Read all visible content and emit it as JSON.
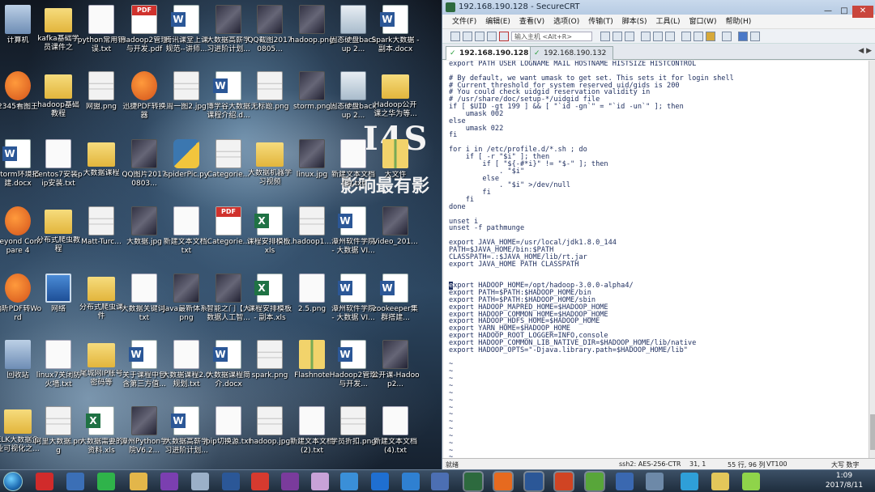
{
  "desktop": {
    "wallpaper_logo": "I4S",
    "wallpaper_subtitle": "影响最有影",
    "icons": [
      {
        "label": "计算机",
        "type": "sys"
      },
      {
        "label": "kafka基础学员课件之",
        "type": "folder"
      },
      {
        "label": "python常用错误.txt",
        "type": "txt"
      },
      {
        "label": "Hadoop2管理与开发.pdf",
        "type": "pdf"
      },
      {
        "label": "腾讯课堂上课规范--讲师...",
        "type": "doc"
      },
      {
        "label": "大数据高薪学习进阶计划...",
        "type": "jpg"
      },
      {
        "label": "QQ截图20170805...",
        "type": "jpg"
      },
      {
        "label": "hadoop.png",
        "type": "jpg"
      },
      {
        "label": "固态硬盘backup 2...",
        "type": "exe"
      },
      {
        "label": "Spark大数据 - 副本.docx",
        "type": "doc"
      },
      {
        "label": "2345看图王",
        "type": "app"
      },
      {
        "label": "hadoop基础教程",
        "type": "folder"
      },
      {
        "label": "网盟.png",
        "type": "png"
      },
      {
        "label": "迅捷PDF转换器",
        "type": "app"
      },
      {
        "label": "周一图2.jpg",
        "type": "png"
      },
      {
        "label": "博学谷大数据课程介绍.d...",
        "type": "doc"
      },
      {
        "label": "无标题.png",
        "type": "png"
      },
      {
        "label": "storm.png",
        "type": "jpg"
      },
      {
        "label": "固态硬盘backup 2...",
        "type": "exe"
      },
      {
        "label": "Hadoop公开课之华为等...",
        "type": "folder"
      },
      {
        "label": "storm环境搭建.docx",
        "type": "doc"
      },
      {
        "label": "centos7安装pip安装.txt",
        "type": "txt"
      },
      {
        "label": "大数据课程",
        "type": "folder"
      },
      {
        "label": "QQ图片20170803...",
        "type": "jpg"
      },
      {
        "label": "spiderPic.py",
        "type": "py"
      },
      {
        "label": "Categorie...",
        "type": "png"
      },
      {
        "label": "大数据机器学习视频",
        "type": "folder"
      },
      {
        "label": "linux.jpg",
        "type": "jpg"
      },
      {
        "label": "新建文本文档(3).txt",
        "type": "txt"
      },
      {
        "label": "大文件",
        "type": "zip"
      },
      {
        "label": "Beyond Compare 4",
        "type": "app"
      },
      {
        "label": "分布式爬虫教程",
        "type": "folder"
      },
      {
        "label": "Matt-Turc...",
        "type": "png"
      },
      {
        "label": "大数据.jpg",
        "type": "jpg"
      },
      {
        "label": "新建文本文档.txt",
        "type": "txt"
      },
      {
        "label": "Categorie...",
        "type": "pdf"
      },
      {
        "label": "课程安排模板.xls",
        "type": "xls"
      },
      {
        "label": "hadoop1...",
        "type": "png"
      },
      {
        "label": "潭州软件学院 - 大数据 VI...",
        "type": "doc"
      },
      {
        "label": "Video_201...",
        "type": "jpg"
      },
      {
        "label": "福昕PDF转Word",
        "type": "app"
      },
      {
        "label": "网络",
        "type": "win"
      },
      {
        "label": "分布式爬虫课件",
        "type": "folder"
      },
      {
        "label": "大数据关键词.txt",
        "type": "txt"
      },
      {
        "label": "Java最新体系.png",
        "type": "jpg"
      },
      {
        "label": "智能之门【大数据人工智...",
        "type": "jpg"
      },
      {
        "label": "课程安排模板 - 副本.xls",
        "type": "xls"
      },
      {
        "label": "2.5.png",
        "type": "txt"
      },
      {
        "label": "潭州软件学院 - 大数据 VI...",
        "type": "doc"
      },
      {
        "label": "zookeeper集群搭建...",
        "type": "doc"
      },
      {
        "label": "回收站",
        "type": "sys"
      },
      {
        "label": "linux7关闭防火墙.txt",
        "type": "txt"
      },
      {
        "label": "尾城网IP账号密码等",
        "type": "folder"
      },
      {
        "label": "关于课程中包含第三方值...",
        "type": "doc"
      },
      {
        "label": "大数据课程2.0规划.txt",
        "type": "txt"
      },
      {
        "label": "大数据课程简介.docx",
        "type": "doc"
      },
      {
        "label": "spark.png",
        "type": "png"
      },
      {
        "label": "Flashnote",
        "type": "zip"
      },
      {
        "label": "Hadoop2管理与开发...",
        "type": "doc"
      },
      {
        "label": "公开课-Hadoop2...",
        "type": "jpg"
      },
      {
        "label": "ELK大数据企业可视化之...",
        "type": "folder"
      },
      {
        "label": "阿里大数据.png",
        "type": "png"
      },
      {
        "label": "大数据需要的资料.xls",
        "type": "xls"
      },
      {
        "label": "潭州Python学院V6.2...",
        "type": "jpg"
      },
      {
        "label": "大数据高薪学习进阶计划...",
        "type": "doc"
      },
      {
        "label": "pip切换源.txt",
        "type": "txt"
      },
      {
        "label": "hadoop.jpg",
        "type": "png"
      },
      {
        "label": "新建文本文档(2).txt",
        "type": "txt"
      },
      {
        "label": "学员折扣.png",
        "type": "png"
      },
      {
        "label": "新建文本文档(4).txt",
        "type": "txt"
      }
    ]
  },
  "crt": {
    "title": "192.168.190.128 - SecureCRT",
    "menu": [
      "文件(F)",
      "编辑(E)",
      "查看(V)",
      "选项(O)",
      "传输(T)",
      "脚本(S)",
      "工具(L)",
      "窗口(W)",
      "帮助(H)"
    ],
    "toolbar_input_placeholder": "输入主机 <Alt+R>",
    "tabs": [
      {
        "label": "192.168.190.128",
        "active": true
      },
      {
        "label": "192.168.190.132",
        "active": false
      }
    ],
    "terminal_lines": [
      "export PATH USER LOGNAME MAIL HOSTNAME HISTSIZE HISTCONTROL",
      "",
      "# By default, we want umask to get set. This sets it for login shell",
      "# Current threshold for system reserved uid/gids is 200",
      "# You could check uidgid reservation validity in",
      "# /usr/share/doc/setup-*/uidgid file",
      "if [ $UID -gt 199 ] && [ \"`id -gn`\" = \"`id -un`\" ]; then",
      "    umask 002",
      "else",
      "    umask 022",
      "fi",
      "",
      "for i in /etc/profile.d/*.sh ; do",
      "    if [ -r \"$i\" ]; then",
      "        if [ \"${-#*i}\" != \"$-\" ]; then",
      "            . \"$i\"",
      "        else",
      "            . \"$i\" >/dev/null",
      "        fi",
      "    fi",
      "done",
      "",
      "unset i",
      "unset -f pathmunge",
      "",
      "export JAVA_HOME=/usr/local/jdk1.8.0_144",
      "PATH=$JAVA_HOME/bin:$PATH",
      "CLASSPATH=.:$JAVA_HOME/lib/rt.jar",
      "export JAVA_HOME PATH CLASSPATH",
      "",
      "",
      "export HADOOP_HOME=/opt/hadoop-3.0.0-alpha4/",
      "export PATH=$PATH:$HADOOP_HOME/bin",
      "export PATH=$PATH:$HADOOP_HOME/sbin",
      "export HADOOP_MAPRED_HOME=$HADOOP_HOME",
      "export HADOOP_COMMON_HOME=$HADOOP_HOME",
      "export HADOOP_HDFS_HOME=$HADOOP_HOME",
      "export YARN_HOME=$HADOOP_HOME",
      "export HADOOP_ROOT_LOGGER=INFO,console",
      "export HADOOP_COMMON_LIB_NATIVE_DIR=$HADOOP_HOME/lib/native",
      "export HADOOP_OPTS=\"-Djava.library.path=$HADOOP_HOME/lib\"",
      "",
      "~",
      "~",
      "~",
      "~",
      "~",
      "~",
      "~",
      "~",
      "~",
      "~",
      "~",
      "~",
      "~",
      "~",
      "~",
      "~",
      "~",
      "~",
      "~"
    ],
    "cursor_line_index": 31,
    "status": {
      "ready": "就绪",
      "encryption": "ssh2: AES-256-CTR",
      "position": "31,   1",
      "rows_cols": "55 行, 96 列",
      "terminal": "VT100",
      "caps": "大写  数字"
    }
  },
  "taskbar": {
    "time": "1:09",
    "date": "2017/8/11",
    "apps": [
      {
        "name": "qq-icon",
        "color": "#d12b2b"
      },
      {
        "name": "explorer-icon",
        "color": "#3b6fb6"
      },
      {
        "name": "wechat-icon",
        "color": "#2fb34a"
      },
      {
        "name": "folder-icon",
        "color": "#e3b64a"
      },
      {
        "name": "intellij-icon",
        "color": "#7b3fb0"
      },
      {
        "name": "box-icon",
        "color": "#9bb0c8"
      },
      {
        "name": "word-icon",
        "color": "#2b5797"
      },
      {
        "name": "youdao-icon",
        "color": "#d63a2f"
      },
      {
        "name": "onenote-icon",
        "color": "#7a3b9c"
      },
      {
        "name": "media-icon",
        "color": "#c8a2d8"
      },
      {
        "name": "arrow-icon",
        "color": "#3a8fd8"
      },
      {
        "name": "teamviewer-icon",
        "color": "#1f6fd1"
      },
      {
        "name": "record-icon",
        "color": "#2f80d1"
      },
      {
        "name": "vs-icon",
        "color": "#4c6fb3"
      },
      {
        "name": "terminal-icon",
        "color": "#2d6a3e"
      },
      {
        "name": "firefox-icon",
        "color": "#e66a1f"
      },
      {
        "name": "word2-icon",
        "color": "#2b5797"
      },
      {
        "name": "ppt-icon",
        "color": "#d04423"
      },
      {
        "name": "green-app-icon",
        "color": "#58a63a"
      },
      {
        "name": "edit-icon",
        "color": "#3a68b0"
      },
      {
        "name": "screen-icon",
        "color": "#6d89a8"
      },
      {
        "name": "globe-icon",
        "color": "#2f9fd8"
      },
      {
        "name": "note-icon",
        "color": "#e3c75a"
      },
      {
        "name": "ball-icon",
        "color": "#8fd44a"
      }
    ]
  }
}
